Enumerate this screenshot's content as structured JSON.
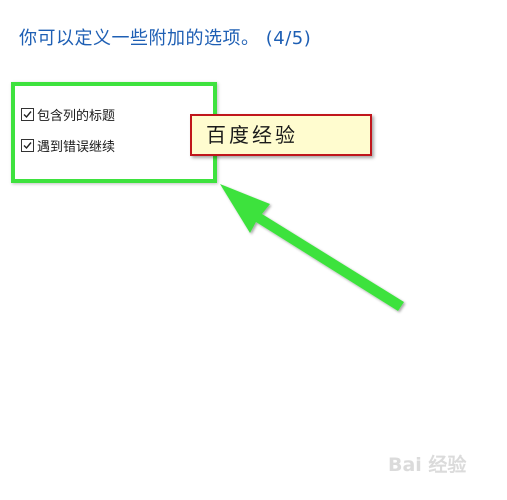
{
  "wizard": {
    "title": "你可以定义一些附加的选项。 (4/5)"
  },
  "options": [
    {
      "label": "包含列的标题",
      "checked": true
    },
    {
      "label": "遇到错误继续",
      "checked": true
    }
  ],
  "annotation": {
    "callout_text": "百度经验",
    "highlight_color": "#3ee23e",
    "callout_border_color": "#c0161c",
    "callout_fill_color": "#fffccf"
  },
  "watermark": {
    "text": "Bai 经验"
  }
}
